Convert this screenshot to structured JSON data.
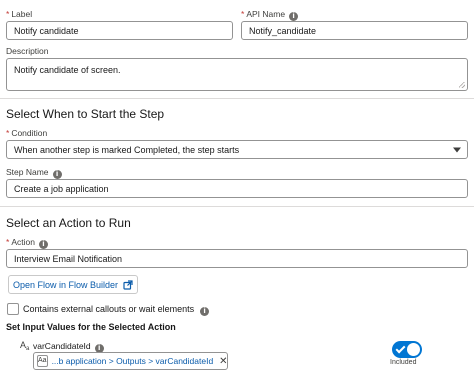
{
  "label_field": {
    "label": "Label",
    "required_mark": "*",
    "value": "Notify candidate"
  },
  "api_name_field": {
    "label": "API Name",
    "required_mark": "*",
    "value": "Notify_candidate",
    "info_icon": "info-icon"
  },
  "description_field": {
    "label": "Description",
    "value": "Notify candidate of screen."
  },
  "start_section": {
    "title": "Select When to Start the Step",
    "condition": {
      "label": "Condition",
      "required_mark": "*",
      "value": "When another step is marked Completed, the step starts"
    },
    "step_name": {
      "label": "Step Name",
      "value": "Create a job application",
      "info_icon": "info-icon"
    }
  },
  "action_section": {
    "title": "Select an Action to Run",
    "action": {
      "label": "Action",
      "required_mark": "*",
      "value": "Interview Email Notification",
      "info_icon": "info-icon"
    },
    "open_flow_button": {
      "label": "Open Flow in Flow Builder",
      "icon": "external-link-icon"
    },
    "callouts_checkbox": {
      "label": "Contains external callouts or wait elements",
      "checked": false,
      "info_icon": "info-icon"
    },
    "input_values_heading": "Set Input Values for the Selected Action",
    "input_var": {
      "type_icon": "text-type-icon",
      "type_glyph": "A",
      "type_sub": "a",
      "name": "varCandidateId",
      "info_icon": "info-icon",
      "pill_icon_text": "Aa",
      "pill_value": "...b application > Outputs > varCandidateId",
      "remove_glyph": "✕",
      "toggle_on": true,
      "toggle_label": "Included"
    }
  },
  "colors": {
    "brand_blue": "#0176d3",
    "link_blue": "#0b5cab",
    "required_red": "#c23934",
    "border": "#939393"
  }
}
